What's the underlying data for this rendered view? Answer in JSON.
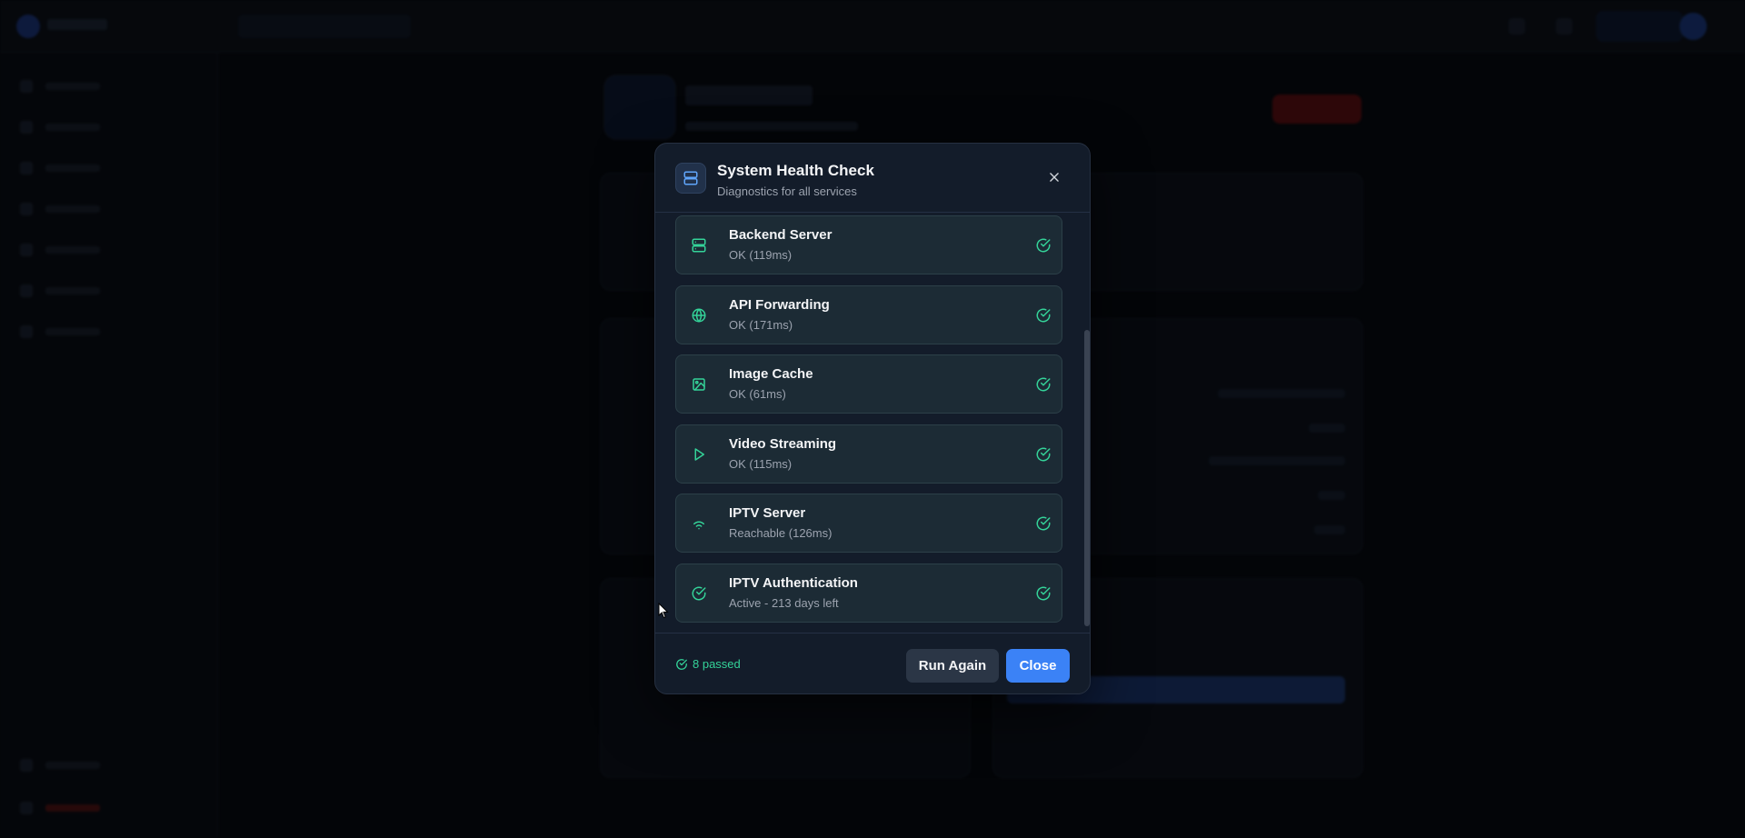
{
  "modal": {
    "title": "System Health Check",
    "subtitle": "Diagnostics for all services",
    "header_icon": "server-icon",
    "close_icon": "close-icon"
  },
  "checks": [
    {
      "name": "Backend Server",
      "status": "OK (119ms)",
      "icon": "server-icon"
    },
    {
      "name": "API Forwarding",
      "status": "OK (171ms)",
      "icon": "globe-icon"
    },
    {
      "name": "Image Cache",
      "status": "OK (61ms)",
      "icon": "image-icon"
    },
    {
      "name": "Video Streaming",
      "status": "OK (115ms)",
      "icon": "play-icon"
    },
    {
      "name": "IPTV Server",
      "status": "Reachable (126ms)",
      "icon": "wifi-icon"
    },
    {
      "name": "IPTV Authentication",
      "status": "Active - 213 days left",
      "icon": "check-circle-icon"
    }
  ],
  "footer": {
    "summary": "8 passed",
    "run_again_label": "Run Again",
    "close_label": "Close"
  },
  "colors": {
    "accent": "#3b82f6",
    "success": "#34d399",
    "modal_bg": "#131c2a",
    "item_bg": "#1c2b35"
  }
}
